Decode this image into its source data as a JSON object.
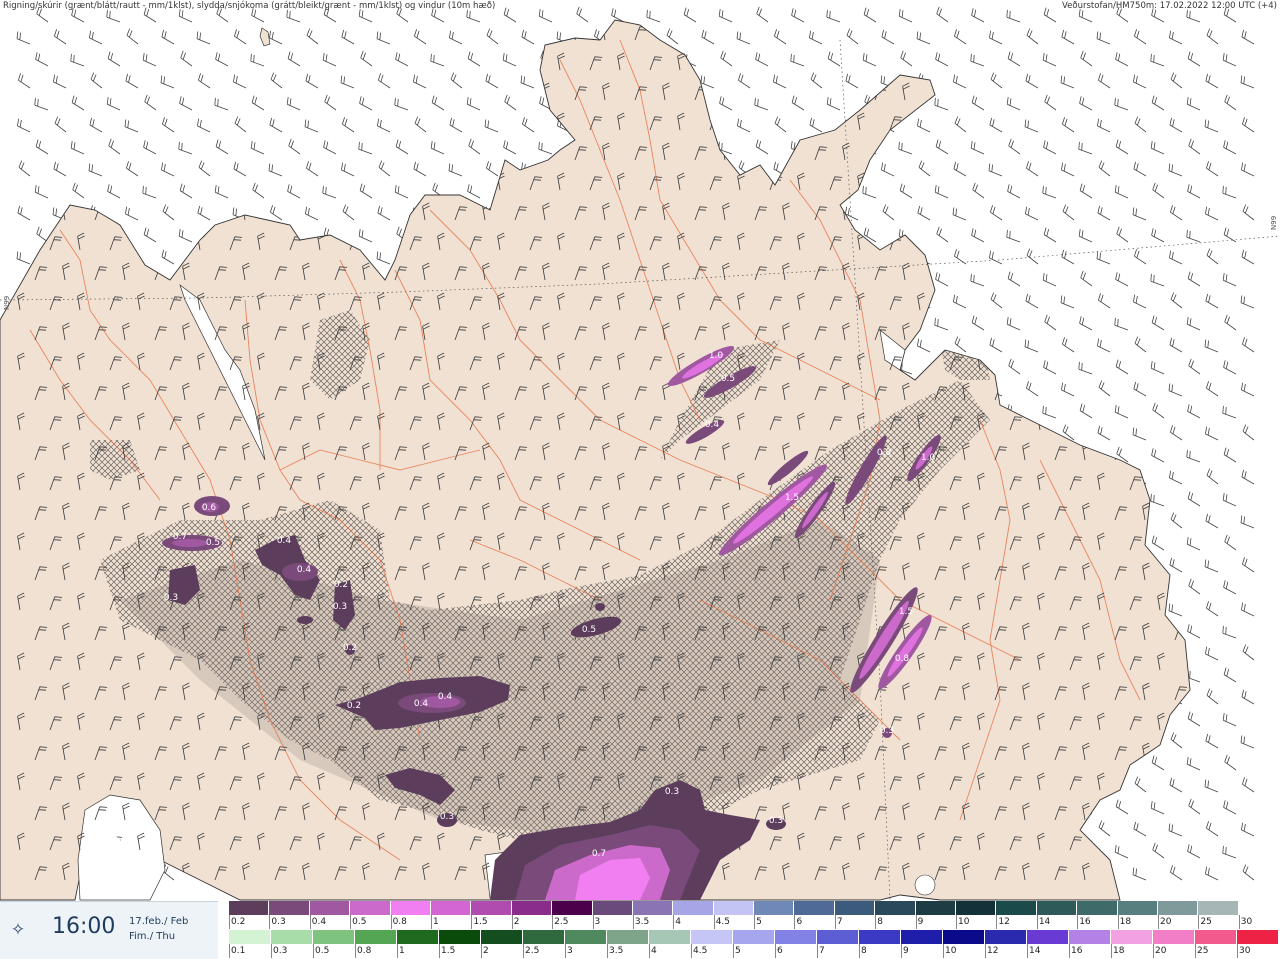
{
  "header": {
    "left": "Rigning/skúrir (grænt/blátt/rautt - mm/1klst), slydda/snjókoma (grátt/bleikt/grænt - mm/1klst) og vindur (10m hæð)",
    "right": "Veðurstofan/HM750m: 17.02.2022 12:00 UTC (+4)"
  },
  "graticule": {
    "lat_label": "N99"
  },
  "time_panel": {
    "icon": "compass-star-icon",
    "time": "16:00",
    "date_line1": "17.feb./ Feb",
    "date_line2": "Fim./ Thu"
  },
  "legend_snow": {
    "labels": [
      "0.2",
      "0.3",
      "0.4",
      "0.5",
      "0.8",
      "1",
      "1.5",
      "2",
      "2.5",
      "3",
      "3.5",
      "4",
      "4.5",
      "5",
      "6",
      "7",
      "8",
      "9",
      "10",
      "12",
      "14",
      "16",
      "18",
      "20",
      "25",
      "30"
    ],
    "colors": [
      "#5c3e5c",
      "#7a4a7a",
      "#a058a0",
      "#cc6acc",
      "#f17ff1",
      "#d466d4",
      "#b04cb0",
      "#8a2d8a",
      "#4a004a",
      "#6a4a7a",
      "#8a74b4",
      "#a6a6e6",
      "#c4c4f4",
      "#7088b8",
      "#506a98",
      "#3c5a7c",
      "#2a4a5c",
      "#1e3c44",
      "#143038",
      "#1a4a4a",
      "#2e5a5a",
      "#3e6a6a",
      "#587f80",
      "#7e9a9a",
      "#a6b6b6",
      "#ffffff"
    ]
  },
  "legend_rain": {
    "labels": [
      "0.1",
      "0.3",
      "0.5",
      "0.8",
      "1",
      "1.5",
      "2",
      "2.5",
      "3",
      "3.5",
      "4",
      "4.5",
      "5",
      "6",
      "7",
      "8",
      "9",
      "10",
      "12",
      "14",
      "16",
      "18",
      "20",
      "25",
      "30"
    ],
    "colors": [
      "#d4f2d4",
      "#a8dca8",
      "#7ec47e",
      "#54a654",
      "#1e6a1e",
      "#0a4a0a",
      "#144e1e",
      "#2e6a3e",
      "#4e8a5e",
      "#7ea48a",
      "#a6c6b6",
      "#c6c6f6",
      "#a6a6ee",
      "#8282e6",
      "#5e5ed4",
      "#3a3ac4",
      "#1e1eaa",
      "#0a0a8a",
      "#2a2aae",
      "#6a3ad4",
      "#b482e6",
      "#f2a2e2",
      "#f27ec8",
      "#f25a8e",
      "#ee2244"
    ]
  },
  "contour_labels": [
    "1.0",
    "0.5",
    "0.4",
    "0.6",
    "0.7",
    "0.5",
    "0.4",
    "0.4",
    "0.3",
    "0.3",
    "0.3",
    "0.2",
    "0.5",
    "0.2",
    "0.4",
    "0.4",
    "0.3",
    "0.3",
    "0.7",
    "1.5",
    "0.8",
    "1.0",
    "1.5",
    "0.8",
    "0.3",
    "0.2"
  ]
}
